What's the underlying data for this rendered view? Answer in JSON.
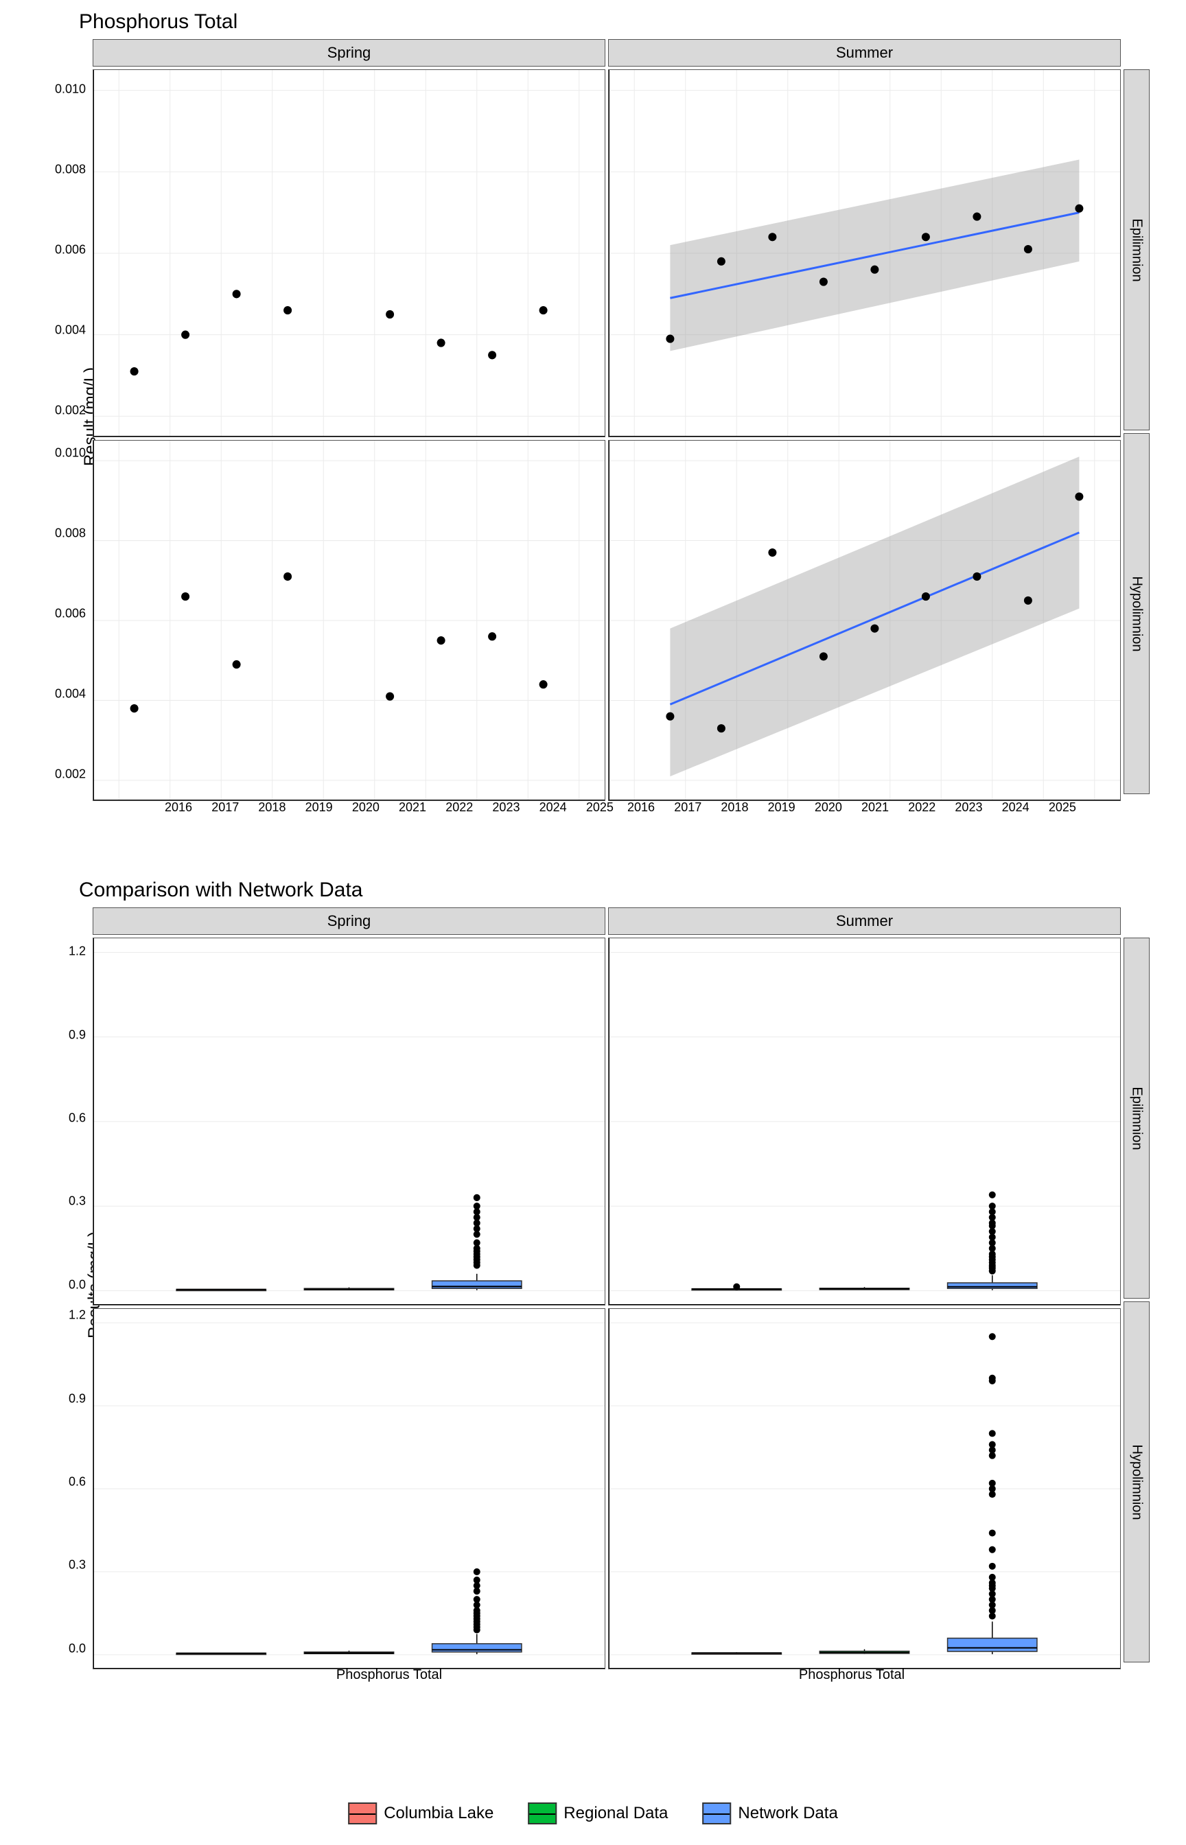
{
  "chart_data": [
    {
      "type": "scatter",
      "title": "Phosphorus Total",
      "xlabel": "",
      "ylabel": "Result (mg/L)",
      "x_ticks": [
        2016,
        2017,
        2018,
        2019,
        2020,
        2021,
        2022,
        2023,
        2024,
        2025
      ],
      "y_ticks": [
        0.002,
        0.004,
        0.006,
        0.008,
        0.01
      ],
      "xlim": [
        2015.5,
        2025.5
      ],
      "ylim": [
        0.0015,
        0.0105
      ],
      "col_facets": [
        "Spring",
        "Summer"
      ],
      "row_facets": [
        "Epilimnion",
        "Hypolimnion"
      ],
      "panels": {
        "Spring_Epilimnion": {
          "points": [
            [
              2016.3,
              0.0031
            ],
            [
              2017.3,
              0.004
            ],
            [
              2018.3,
              0.005
            ],
            [
              2019.3,
              0.0046
            ],
            [
              2021.3,
              0.0045
            ],
            [
              2022.3,
              0.0038
            ],
            [
              2023.3,
              0.0035
            ],
            [
              2024.3,
              0.0046
            ]
          ],
          "trend": null
        },
        "Summer_Epilimnion": {
          "points": [
            [
              2016.7,
              0.0039
            ],
            [
              2017.7,
              0.0058
            ],
            [
              2018.7,
              0.0064
            ],
            [
              2019.7,
              0.0053
            ],
            [
              2020.7,
              0.0056
            ],
            [
              2021.7,
              0.0064
            ],
            [
              2022.7,
              0.0069
            ],
            [
              2023.7,
              0.0061
            ],
            [
              2024.7,
              0.0071
            ]
          ],
          "trend": {
            "x": [
              2016.7,
              2024.7
            ],
            "y": [
              0.0049,
              0.007
            ],
            "ribbon_lo": [
              0.0036,
              0.0058
            ],
            "ribbon_hi": [
              0.0062,
              0.0083
            ]
          }
        },
        "Spring_Hypolimnion": {
          "points": [
            [
              2016.3,
              0.0038
            ],
            [
              2017.3,
              0.0066
            ],
            [
              2018.3,
              0.0049
            ],
            [
              2019.3,
              0.0071
            ],
            [
              2021.3,
              0.0041
            ],
            [
              2022.3,
              0.0055
            ],
            [
              2023.3,
              0.0056
            ],
            [
              2024.3,
              0.0044
            ]
          ],
          "trend": null
        },
        "Summer_Hypolimnion": {
          "points": [
            [
              2016.7,
              0.0036
            ],
            [
              2017.7,
              0.0033
            ],
            [
              2018.7,
              0.0077
            ],
            [
              2019.7,
              0.0051
            ],
            [
              2020.7,
              0.0058
            ],
            [
              2021.7,
              0.0066
            ],
            [
              2022.7,
              0.0071
            ],
            [
              2023.7,
              0.0065
            ],
            [
              2024.7,
              0.0091
            ]
          ],
          "trend": {
            "x": [
              2016.7,
              2024.7
            ],
            "y": [
              0.0039,
              0.0082
            ],
            "ribbon_lo": [
              0.0021,
              0.0063
            ],
            "ribbon_hi": [
              0.0058,
              0.0101
            ]
          }
        }
      }
    },
    {
      "type": "boxplot",
      "title": "Comparison with Network Data",
      "xlabel": "Phosphorus Total",
      "ylabel": "Results (mg/L)",
      "y_ticks": [
        0.0,
        0.3,
        0.6,
        0.9,
        1.2
      ],
      "ylim": [
        -0.05,
        1.25
      ],
      "col_facets": [
        "Spring",
        "Summer"
      ],
      "row_facets": [
        "Epilimnion",
        "Hypolimnion"
      ],
      "series": [
        "Columbia Lake",
        "Regional Data",
        "Network Data"
      ],
      "colors": {
        "Columbia Lake": "#f8766d",
        "Regional Data": "#00ba38",
        "Network Data": "#619cff"
      },
      "panels": {
        "Spring_Epilimnion": {
          "boxes": [
            {
              "series": "Columbia Lake",
              "q1": 0.003,
              "med": 0.004,
              "q3": 0.005,
              "lo": 0.003,
              "hi": 0.005,
              "outliers": []
            },
            {
              "series": "Regional Data",
              "q1": 0.003,
              "med": 0.005,
              "q3": 0.008,
              "lo": 0.002,
              "hi": 0.012,
              "outliers": []
            },
            {
              "series": "Network Data",
              "q1": 0.008,
              "med": 0.015,
              "q3": 0.035,
              "lo": 0.002,
              "hi": 0.06,
              "outliers": [
                0.09,
                0.1,
                0.11,
                0.12,
                0.13,
                0.14,
                0.15,
                0.17,
                0.2,
                0.22,
                0.24,
                0.26,
                0.28,
                0.3,
                0.33
              ]
            }
          ]
        },
        "Summer_Epilimnion": {
          "boxes": [
            {
              "series": "Columbia Lake",
              "q1": 0.005,
              "med": 0.006,
              "q3": 0.007,
              "lo": 0.004,
              "hi": 0.007,
              "outliers": [
                0.014
              ]
            },
            {
              "series": "Regional Data",
              "q1": 0.004,
              "med": 0.006,
              "q3": 0.009,
              "lo": 0.003,
              "hi": 0.013,
              "outliers": []
            },
            {
              "series": "Network Data",
              "q1": 0.008,
              "med": 0.014,
              "q3": 0.028,
              "lo": 0.002,
              "hi": 0.055,
              "outliers": [
                0.07,
                0.08,
                0.085,
                0.09,
                0.1,
                0.11,
                0.12,
                0.13,
                0.15,
                0.17,
                0.19,
                0.21,
                0.23,
                0.24,
                0.26,
                0.28,
                0.3,
                0.34
              ]
            }
          ]
        },
        "Spring_Hypolimnion": {
          "boxes": [
            {
              "series": "Columbia Lake",
              "q1": 0.004,
              "med": 0.005,
              "q3": 0.006,
              "lo": 0.004,
              "hi": 0.007,
              "outliers": []
            },
            {
              "series": "Regional Data",
              "q1": 0.004,
              "med": 0.006,
              "q3": 0.01,
              "lo": 0.003,
              "hi": 0.015,
              "outliers": []
            },
            {
              "series": "Network Data",
              "q1": 0.01,
              "med": 0.018,
              "q3": 0.04,
              "lo": 0.002,
              "hi": 0.075,
              "outliers": [
                0.09,
                0.1,
                0.11,
                0.12,
                0.13,
                0.14,
                0.15,
                0.16,
                0.18,
                0.2,
                0.23,
                0.25,
                0.27,
                0.3
              ]
            }
          ]
        },
        "Summer_Hypolimnion": {
          "boxes": [
            {
              "series": "Columbia Lake",
              "q1": 0.004,
              "med": 0.006,
              "q3": 0.007,
              "lo": 0.003,
              "hi": 0.009,
              "outliers": []
            },
            {
              "series": "Regional Data",
              "q1": 0.005,
              "med": 0.008,
              "q3": 0.013,
              "lo": 0.003,
              "hi": 0.02,
              "outliers": []
            },
            {
              "series": "Network Data",
              "q1": 0.012,
              "med": 0.025,
              "q3": 0.06,
              "lo": 0.002,
              "hi": 0.12,
              "outliers": [
                0.14,
                0.16,
                0.18,
                0.2,
                0.22,
                0.24,
                0.25,
                0.26,
                0.28,
                0.32,
                0.38,
                0.44,
                0.58,
                0.6,
                0.62,
                0.72,
                0.74,
                0.76,
                0.8,
                0.99,
                1.0,
                1.15
              ]
            }
          ]
        }
      }
    }
  ],
  "legend": {
    "items": [
      "Columbia Lake",
      "Regional Data",
      "Network Data"
    ]
  }
}
